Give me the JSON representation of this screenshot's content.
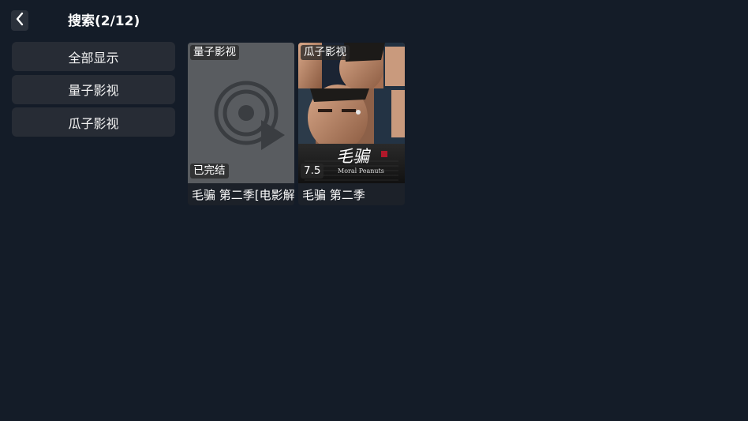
{
  "header": {
    "title": "搜索(2/12)",
    "back_icon": "chevron-left-icon"
  },
  "sidebar": {
    "items": [
      {
        "label": "全部显示"
      },
      {
        "label": "量子影视"
      },
      {
        "label": "瓜子影视"
      }
    ]
  },
  "results": [
    {
      "source": "量子影视",
      "badge": "已完结",
      "title": "毛骗 第二季[电影解",
      "poster": "placeholder-play-icon"
    },
    {
      "source": "瓜子影视",
      "badge": "7.5",
      "title": "毛骗 第二季",
      "poster_title": "毛骗",
      "poster_subtitle": "Moral Peanuts"
    }
  ],
  "colors": {
    "background": "#141c28",
    "sidebar_item": "#272c35",
    "placeholder": "#595c60"
  }
}
